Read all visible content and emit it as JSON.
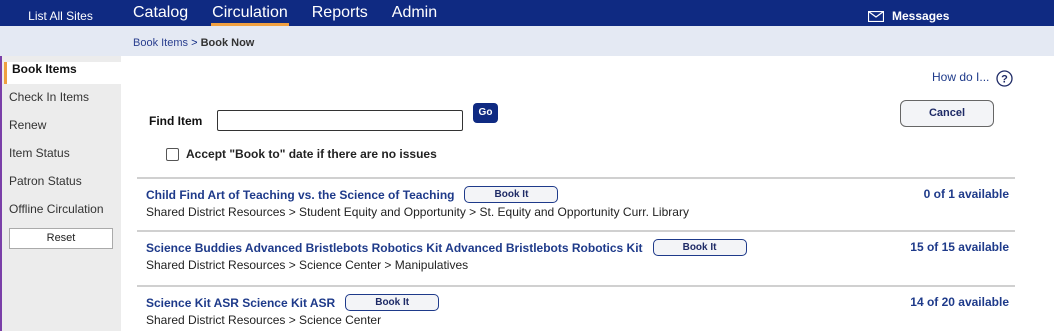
{
  "topbar": {
    "site_link": "List All Sites",
    "nav": [
      "Catalog",
      "Circulation",
      "Reports",
      "Admin"
    ],
    "active_nav": "Circulation",
    "messages": "Messages"
  },
  "breadcrumb": {
    "link": "Book Items",
    "separator": " > ",
    "current": "Book Now"
  },
  "sidebar": {
    "items": [
      {
        "label": "Book Items",
        "active": true
      },
      {
        "label": "Check In Items",
        "active": false
      },
      {
        "label": "Renew",
        "active": false
      },
      {
        "label": "Item Status",
        "active": false
      },
      {
        "label": "Patron Status",
        "active": false
      },
      {
        "label": "Offline Circulation",
        "active": false
      }
    ],
    "reset_label": "Reset"
  },
  "main": {
    "how_do": "How do I...",
    "find_label": "Find Item",
    "find_value": "",
    "go_label": "Go",
    "cancel_label": "Cancel",
    "accept_label": "Accept \"Book to\" date if there are no issues",
    "accept_checked": false
  },
  "results": [
    {
      "title": "Child Find Art of Teaching vs. the Science of Teaching",
      "button": "Book It",
      "path": "Shared District Resources > Student Equity and Opportunity > St. Equity and Opportunity Curr. Library",
      "availability": "0 of 1 available"
    },
    {
      "title": "Science Buddies Advanced Bristlebots Robotics Kit Advanced Bristlebots Robotics Kit",
      "button": "Book It",
      "path": "Shared District Resources > Science Center > Manipulatives",
      "availability": "15 of 15 available"
    },
    {
      "title": "Science Kit ASR Science Kit ASR",
      "button": "Book It",
      "path": "Shared District Resources > Science Center",
      "availability": "14 of 20 available"
    }
  ],
  "colors": {
    "topbar": "#0f2a82",
    "accent": "#f0a040",
    "link": "#1e3a8a"
  }
}
